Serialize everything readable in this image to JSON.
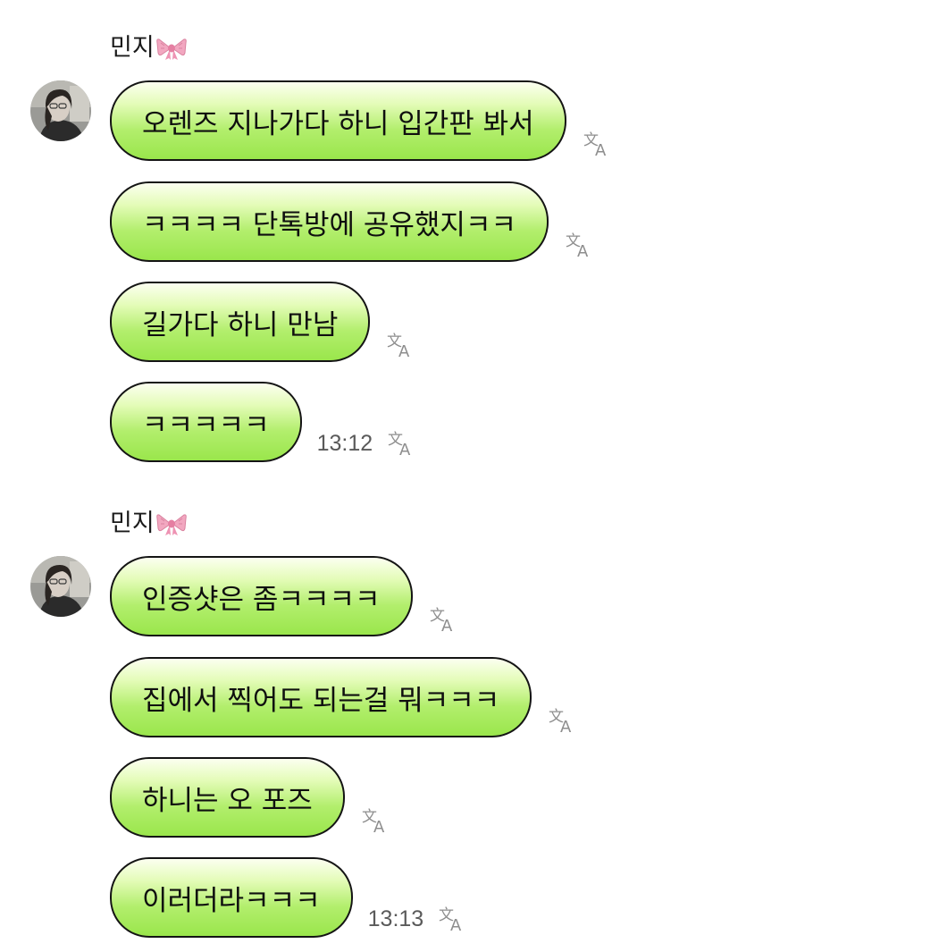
{
  "groups": [
    {
      "sender": "민지",
      "sender_emoji": "bow-ribbon-icon",
      "messages": [
        {
          "text": "오렌즈 지나가다 하니 입간판 봐서",
          "time": ""
        },
        {
          "text": "ㅋㅋㅋㅋ 단톡방에 공유했지ㅋㅋ",
          "time": ""
        },
        {
          "text": "길가다 하니 만남",
          "time": ""
        },
        {
          "text": "ㅋㅋㅋㅋㅋ",
          "time": "13:12"
        }
      ]
    },
    {
      "sender": "민지",
      "sender_emoji": "bow-ribbon-icon",
      "messages": [
        {
          "text": "인증샷은 좀ㅋㅋㅋㅋ",
          "time": ""
        },
        {
          "text": "집에서 찍어도 되는걸 뭐ㅋㅋㅋ",
          "time": ""
        },
        {
          "text": "하니는 오 포즈",
          "time": ""
        },
        {
          "text": "이러더라ㅋㅋㅋ",
          "time": "13:13"
        }
      ]
    }
  ],
  "colors": {
    "bubble_top": "#fcfff0",
    "bubble_bottom": "#9ae64c",
    "bubble_border": "#141414",
    "time_text": "#5a5a5a",
    "bow": "#f2a7c0"
  }
}
